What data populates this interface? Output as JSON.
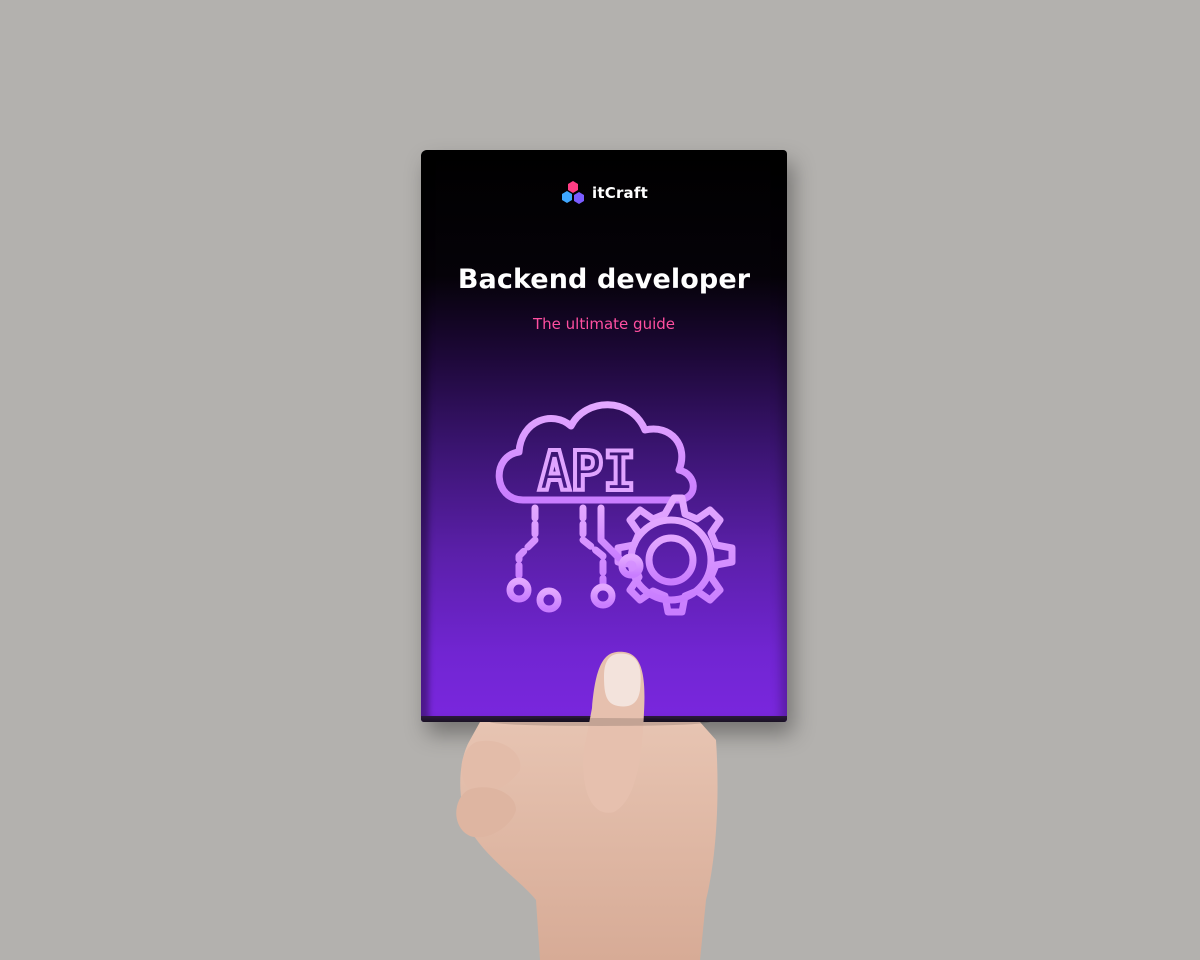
{
  "cover": {
    "brand": "itCraft",
    "title": "Backend developer",
    "subtitle": "The ultimate guide",
    "illustration_text": "API"
  },
  "colors": {
    "background": "#b3b1ae",
    "cover_top": "#000000",
    "cover_bottom": "#7a27de",
    "title": "#ffffff",
    "subtitle": "#ff4fa0",
    "illustration_stroke": "#d79cff",
    "logo_pink": "#ff3d84",
    "logo_blue": "#3fa7ff",
    "logo_purple": "#7a5cff"
  },
  "icons": [
    "itcraft-logo-icon",
    "cloud-api-icon",
    "gear-icon",
    "circuit-icon",
    "hand-icon"
  ]
}
